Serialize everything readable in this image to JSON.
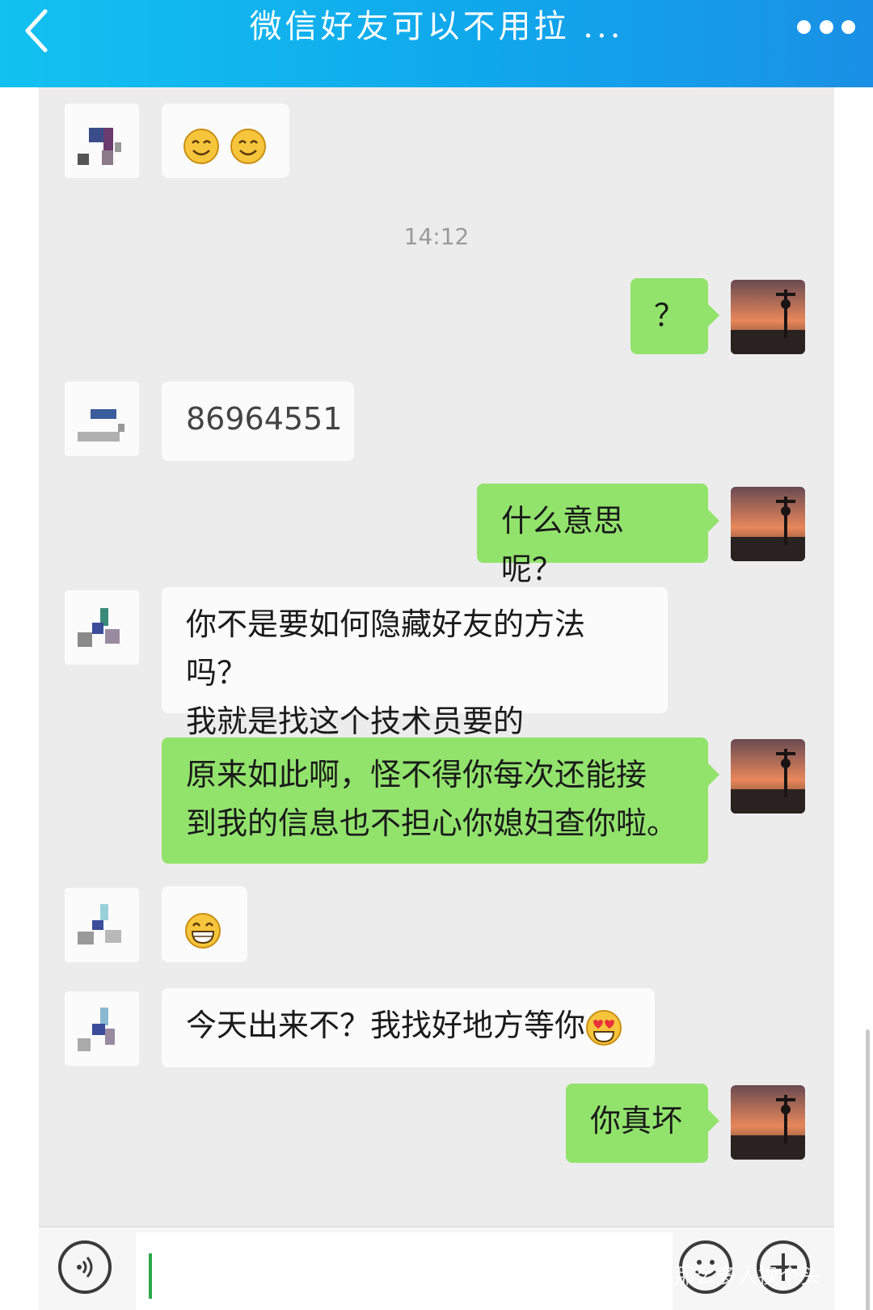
{
  "header": {
    "title": "微信好友可以不用拉 ...",
    "back_icon": "chevron-left-icon",
    "more_icon": "more-dots-icon",
    "background": "#12c1f0"
  },
  "timestamp": "14:12",
  "messages": [
    {
      "side": "in",
      "text": "",
      "emoji": [
        "smile-emoji",
        "smile-emoji"
      ]
    },
    {
      "side": "out",
      "text": "？"
    },
    {
      "side": "in",
      "text": "86964551"
    },
    {
      "side": "out",
      "text": "什么意思呢？"
    },
    {
      "side": "in",
      "lines": [
        "你不是要如何隐藏好友的方法吗？",
        "我就是找这个技术员要的"
      ]
    },
    {
      "side": "out",
      "lines": [
        "原来如此啊，怪不得你每次还能接",
        "到我的信息也不担心你媳妇查你啦。"
      ]
    },
    {
      "side": "in",
      "text": "",
      "emoji": [
        "grin-emoji"
      ]
    },
    {
      "side": "in",
      "text": "今天出来不？我找好地方等你",
      "emoji": [
        "heart-eyes-emoji"
      ]
    },
    {
      "side": "out",
      "text": "你真坏"
    }
  ],
  "input_bar": {
    "value": "",
    "voice_icon": "voice-icon",
    "emoji_icon": "emoji-icon",
    "plus_icon": "plus-icon"
  },
  "colors": {
    "outgoing_bubble": "#92e36c",
    "incoming_bubble": "#fbfbfb",
    "chat_background": "#ececec"
  },
  "watermark": "让那么多人换个头"
}
